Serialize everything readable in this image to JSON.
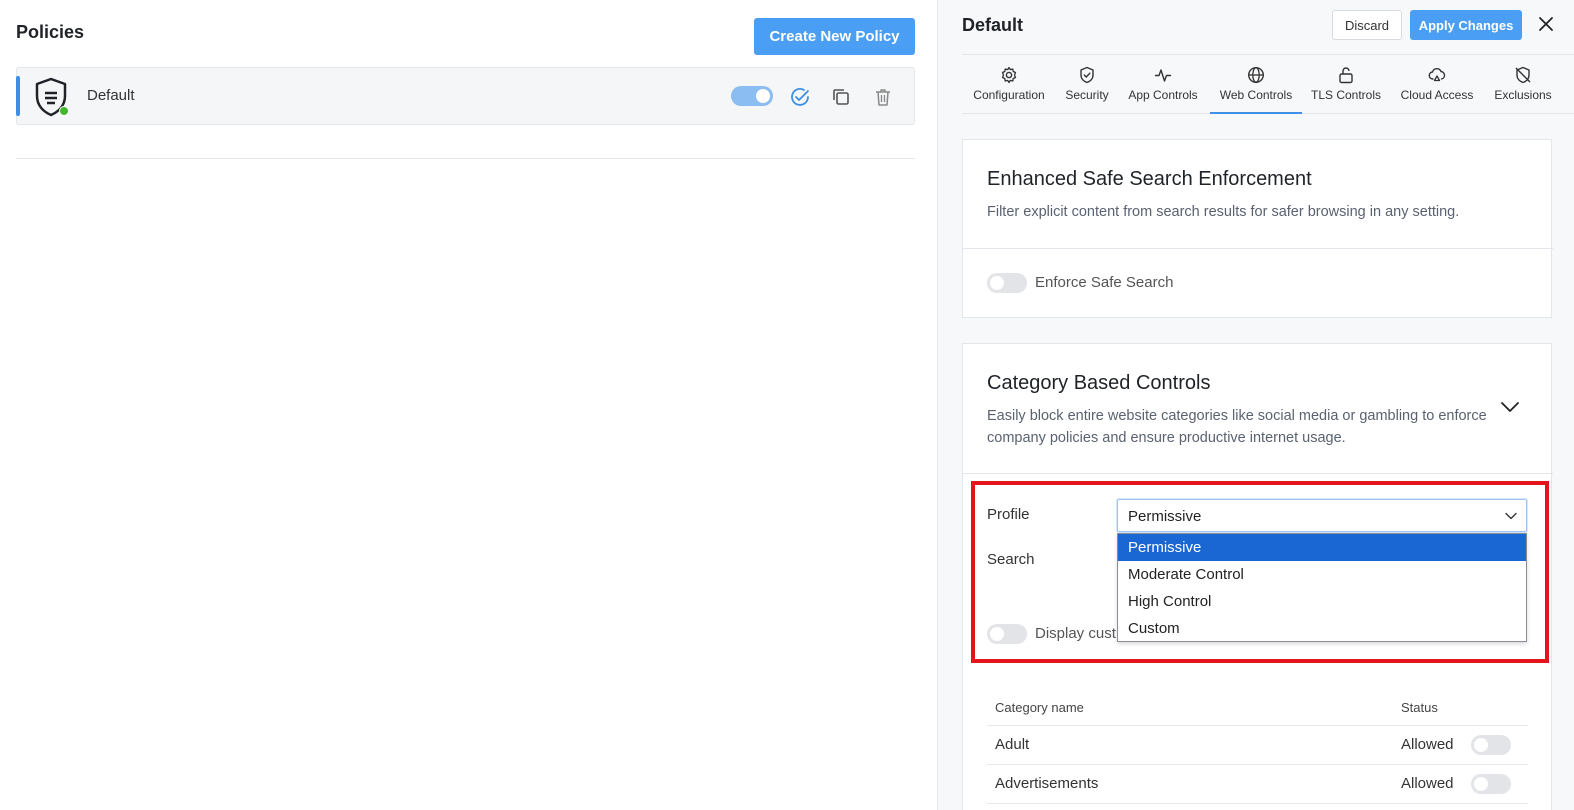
{
  "policies": {
    "title": "Policies",
    "create_label": "Create New Policy",
    "items": [
      {
        "name": "Default",
        "enabled": true,
        "status": "active"
      }
    ]
  },
  "panel": {
    "title": "Default",
    "discard_label": "Discard",
    "apply_label": "Apply Changes",
    "tabs": [
      {
        "label": "Configuration",
        "icon": "gear-icon"
      },
      {
        "label": "Security",
        "icon": "shield-check-icon"
      },
      {
        "label": "App Controls",
        "icon": "activity-icon"
      },
      {
        "label": "Web Controls",
        "icon": "globe-icon",
        "active": true
      },
      {
        "label": "TLS Controls",
        "icon": "unlock-icon"
      },
      {
        "label": "Cloud Access",
        "icon": "cloud-icon"
      },
      {
        "label": "Exclusions",
        "icon": "shield-off-icon"
      }
    ]
  },
  "safe_search": {
    "title": "Enhanced Safe Search Enforcement",
    "description": "Filter explicit content from search results for safer browsing in any setting.",
    "toggle_label": "Enforce Safe Search",
    "enabled": false
  },
  "category_controls": {
    "title": "Category Based Controls",
    "description": "Easily block entire website categories like social media or gambling to enforce company policies and ensure productive internet usage.",
    "profile_label": "Profile",
    "profile_value": "Permissive",
    "profile_options": [
      "Permissive",
      "Moderate Control",
      "High Control",
      "Custom"
    ],
    "search_label": "Search",
    "display_toggle_label": "Display cust",
    "table": {
      "col_name": "Category name",
      "col_status": "Status",
      "rows": [
        {
          "name": "Adult",
          "status": "Allowed"
        },
        {
          "name": "Advertisements",
          "status": "Allowed"
        }
      ]
    }
  },
  "colors": {
    "accent": "#4a9ff5",
    "highlight": "#e3141b",
    "selected_option": "#1a66d2",
    "status_green": "#42b72a"
  }
}
